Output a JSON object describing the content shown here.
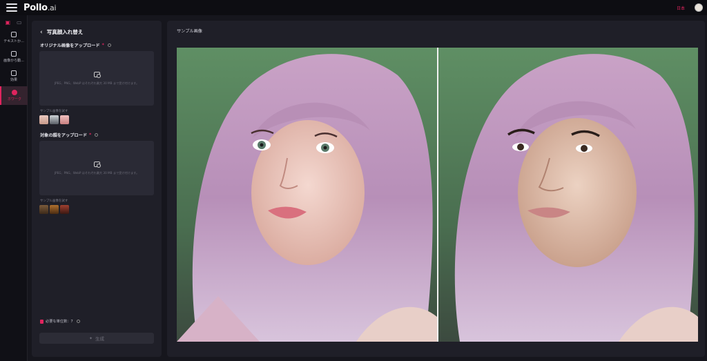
{
  "app": {
    "logo_main": "Pollo",
    "logo_suffix": ".ai"
  },
  "topbar": {
    "language": "日本"
  },
  "rail": {
    "items": [
      {
        "label": "テキストか..."
      },
      {
        "label": "画像から動..."
      },
      {
        "label": "効果"
      },
      {
        "label": "ホワーク"
      }
    ]
  },
  "panel": {
    "title": "写真顔入れ替え",
    "original_section": {
      "title": "オリジナル画像をアップロード",
      "hint": "JPEG、PNG、WebP はそれぞれ最大 30 MB まで受け付けます。"
    },
    "original_samples_label": "サンプル画像を試す",
    "target_section": {
      "title": "対象の顔をアップロード",
      "hint": "JPEG、PNG、WebP はそれぞれ最大 30 MB まで受け付けます。"
    },
    "target_samples_label": "サンプル画像を試す",
    "credits_text": "必要な単位数：7",
    "generate_label": "生成"
  },
  "main": {
    "label": "サンプル画像"
  },
  "colors": {
    "accent": "#e0245e",
    "panel": "#1f1f28",
    "background": "#16161d"
  },
  "icons": [
    "menu-icon",
    "back-icon",
    "upload-icon",
    "info-icon",
    "sparkle-icon",
    "credit-icon"
  ]
}
